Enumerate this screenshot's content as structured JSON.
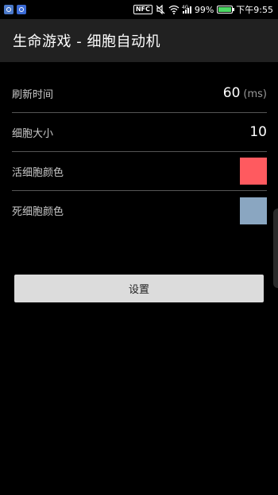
{
  "status_bar": {
    "nfc": "NFC",
    "signal_label": "4G",
    "battery_percent": "99%",
    "battery_level": 0.99,
    "time": "下午9:55",
    "icons": [
      "app-icon-1",
      "app-icon-2",
      "nfc-icon",
      "mute-icon",
      "wifi-icon",
      "signal-icon",
      "battery-icon"
    ]
  },
  "app_bar": {
    "title": "生命游戏 - 细胞自动机",
    "background": "#212121"
  },
  "settings": {
    "refresh": {
      "label": "刷新时间",
      "value": "60",
      "unit": "(ms)"
    },
    "cell_size": {
      "label": "细胞大小",
      "value": "10"
    },
    "alive_color": {
      "label": "活细胞颜色",
      "color": "#ff5a5f"
    },
    "dead_color": {
      "label": "死细胞颜色",
      "color": "#8aa6c1"
    }
  },
  "button": {
    "label": "设置"
  }
}
